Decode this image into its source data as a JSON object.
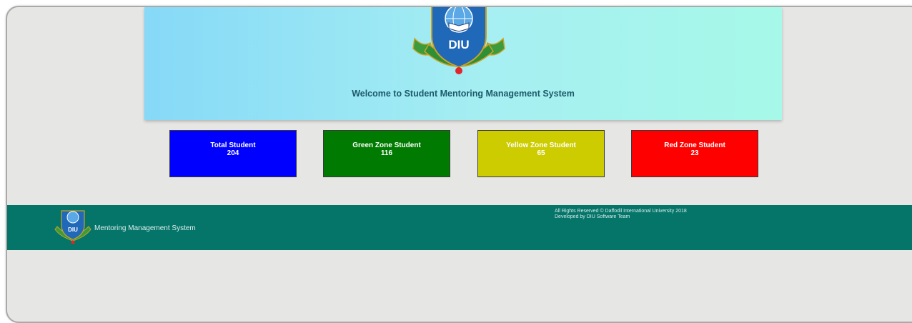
{
  "banner": {
    "welcome_text": "Welcome to Student Mentoring Management System",
    "logo_text": "DIU"
  },
  "stats": [
    {
      "label": "Total Student",
      "value": "204",
      "color": "#0000ff"
    },
    {
      "label": "Green Zone Student",
      "value": "116",
      "color": "#007a00"
    },
    {
      "label": "Yellow Zone Student",
      "value": "65",
      "color": "#cccc00"
    },
    {
      "label": "Red Zone Student",
      "value": "23",
      "color": "#ff0000"
    }
  ],
  "footer": {
    "title": "Mentoring Management System",
    "copyright": "All Rights Reserved © Daffodil International University 2018",
    "developer": "Developed by DIU Software Team",
    "background": "#05756a"
  }
}
